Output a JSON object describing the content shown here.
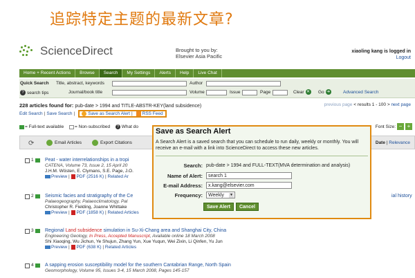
{
  "slide_title": "追踪特定主题的最新文章?",
  "header": {
    "logo_text": "ScienceDirect",
    "brought_line1": "Brought to you by:",
    "brought_line2": "Elsevier Asia Pacific",
    "user_text": "xiaoling kang is logged in",
    "logout": "Logout"
  },
  "nav": {
    "items": [
      "Home + Recent Actions",
      "Browse",
      "Search",
      "My Settings",
      "Alerts",
      "Help",
      "Live Chat"
    ],
    "active": "Search"
  },
  "quick_search": {
    "label": "Quick Search",
    "title_label": "Title, abstract, keywords",
    "author_label": "Author",
    "tips": "search tips",
    "journal_label": "Journal/book title",
    "volume_label": "Volume",
    "issue_label": "Issue",
    "page_label": "Page",
    "clear": "Clear",
    "go": "Go",
    "advanced": "Advanced Search"
  },
  "results": {
    "count": "228 articles found for:",
    "query": "pub-date > 1994 and TITLE-ABSTR-KEY(land subsidence)",
    "pager_prev": "previous page",
    "pager_range": "< results 1 - 100 >",
    "pager_next": "next page",
    "edit_search": "Edit Search",
    "save_search": "Save Search",
    "save_alert": "Save as Search Alert",
    "rss": "RSS Feed"
  },
  "legend": {
    "full": "= Full-text available",
    "non": "= Non-subscribed",
    "what": "What do",
    "font_size": "Font Size:"
  },
  "toolbar": {
    "email": "Email Articles",
    "export": "Export Citations",
    "sort_label": "Date",
    "sort_relevance": "Relevance"
  },
  "articles": [
    {
      "num": "1",
      "title": "Peat - water interrelationships in a tropi",
      "journal": "CATENA, Volume 73, Issue 2, 15 April 20",
      "authors": "J.H.M. Wösten, E. Clymans, S.E. Page, J.O.",
      "preview": "Preview",
      "pdf": "PDF (2516 K)",
      "related": "Related Ar"
    },
    {
      "num": "2",
      "title": "Seismic facies and stratigraphy of the Ce",
      "title_end": "ial history",
      "journal": "Palaeogeography, Palaeoclimatology, Pal",
      "authors": "Christopher R. Fielding, Joanne Whittake",
      "preview": "Preview",
      "pdf": "PDF (1858 K)",
      "related": "Related Articles"
    },
    {
      "num": "3",
      "title_pre": "Regional ",
      "title_hl": "Land subsidence",
      "title_post": " simulation in Su-Xi-Chang area and Shanghai City, China",
      "journal_pre": "Engineering Geology, ",
      "journal_red": "In Press, Accepted Manuscript",
      "journal_post": ", Available online 18 March 2008",
      "authors": "Shi Xiaoqing, Wu Jichun, Ye Shujun, Zhang Yun, Xue Yuqun, Wei Zixin, Li Qinfen, Yu Jun",
      "preview": "Preview",
      "pdf": "PDF (638 K)",
      "related": "Related Articles"
    },
    {
      "num": "4",
      "title": "A sapping erosion susceptibility model for the southern Cantabrian Range, North Spain",
      "journal": "Geomorphology, Volume 95, Issues 3-4, 15 March 2008, Pages 145-157"
    }
  ],
  "dialog": {
    "title": "Save as Search Alert",
    "desc": "A Search Alert is a saved search that you can schedule to run daily, weekly or monthly. You will receive an e-mail with a link into ScienceDirect to access these new articles.",
    "search_label": "Search:",
    "search_value": "pub-date > 1994 and FULL-TEXT(MVA determination and analysis)",
    "name_label": "Name of Alert:",
    "name_value": "search 1",
    "email_label": "E-mail Address:",
    "email_value": "x.kang@elsevier.com",
    "freq_label": "Frequency:",
    "freq_value": "Weekly",
    "save_btn": "Save Alert",
    "cancel_btn": "Cancel"
  }
}
